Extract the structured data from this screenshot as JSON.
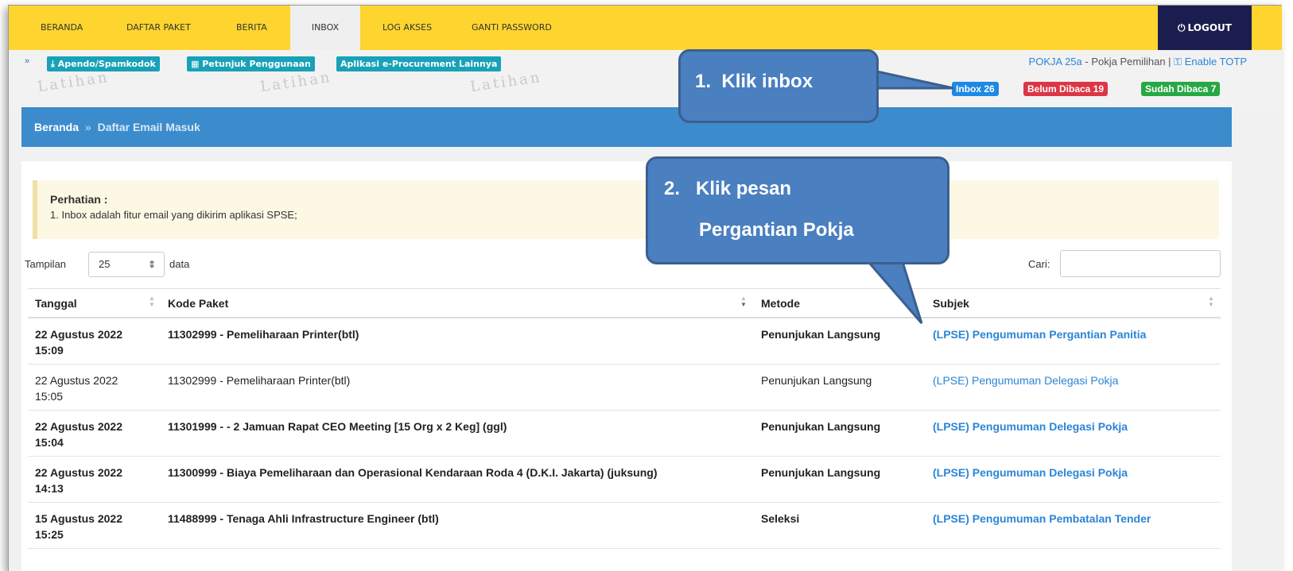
{
  "nav": {
    "items": [
      {
        "label": "BERANDA"
      },
      {
        "label": "DAFTAR PAKET"
      },
      {
        "label": "BERITA"
      },
      {
        "label": "INBOX"
      },
      {
        "label": "LOG AKSES"
      },
      {
        "label": "GANTI PASSWORD"
      }
    ],
    "active": "INBOX",
    "logout_label": "LOGOUT",
    "logout_icon": "power-icon"
  },
  "toolbar": {
    "collapse_icon": "double-chevron-up-icon",
    "buttons": [
      {
        "label": "Apendo/Spamkodok",
        "icon": "download-icon"
      },
      {
        "label": "Petunjuk Penggunaan",
        "icon": "book-icon"
      },
      {
        "label": "Aplikasi e-Procurement Lainnya",
        "icon": ""
      }
    ],
    "watermark": "Latihan"
  },
  "user": {
    "name": "POKJA 25a",
    "role": "- Pokja Pemilihan |",
    "totp_label": "Enable TOTP",
    "totp_icon": "key-icon"
  },
  "badges": {
    "inbox": "Inbox 26",
    "unread": "Belum Dibaca 19",
    "read": "Sudah Dibaca 7",
    "colors": {
      "inbox": "#1e88e5",
      "unread": "#dc3545",
      "read": "#28a745"
    }
  },
  "breadcrumb": {
    "home": "Beranda",
    "separator": "»",
    "current": "Daftar Email Masuk"
  },
  "alert": {
    "title": "Perhatian :",
    "text": "1. Inbox adalah fitur email yang dikirim aplikasi SPSE;"
  },
  "length_menu": {
    "prefix": "Tampilan",
    "value": "25",
    "suffix": "data"
  },
  "search": {
    "label": "Cari:",
    "value": ""
  },
  "table": {
    "headers": [
      "Tanggal",
      "Kode Paket",
      "Metode",
      "Subjek"
    ],
    "rows": [
      {
        "date": "22 Agustus 2022",
        "time": "15:09",
        "kode": "11302999",
        "nama": "- Pemeliharaan Printer(btl)",
        "metode": "Penunjukan Langsung",
        "subjek": "(LPSE) Pengumuman Pergantian Panitia",
        "unread": true
      },
      {
        "date": "22 Agustus 2022",
        "time": "15:05",
        "kode": "11302999",
        "nama": "- Pemeliharaan Printer(btl)",
        "metode": "Penunjukan Langsung",
        "subjek": "(LPSE) Pengumuman Delegasi Pokja",
        "unread": false
      },
      {
        "date": "22 Agustus 2022",
        "time": "15:04",
        "kode": "11301999",
        "nama": "- - 2 Jamuan Rapat CEO Meeting [15 Org x 2 Keg] (ggl)",
        "metode": "Penunjukan Langsung",
        "subjek": "(LPSE) Pengumuman Delegasi Pokja",
        "unread": true
      },
      {
        "date": "22 Agustus 2022",
        "time": "14:13",
        "kode": "11300999",
        "nama": "- Biaya Pemeliharaan dan Operasional Kendaraan Roda 4 (D.K.I. Jakarta) (juksung)",
        "metode": "Penunjukan Langsung",
        "subjek": "(LPSE) Pengumuman Delegasi Pokja",
        "unread": true
      },
      {
        "date": "15 Agustus 2022",
        "time": "15:25",
        "kode": "11488999",
        "nama": "- Tenaga Ahli Infrastructure Engineer (btl)",
        "metode": "Seleksi",
        "subjek": "(LPSE) Pengumuman Pembatalan Tender",
        "unread": true
      }
    ]
  },
  "callouts": {
    "one": {
      "num": "1.",
      "text": "Klik inbox"
    },
    "two": {
      "num": "2.",
      "line1": "Klik pesan",
      "line2": "Pergantian Pokja"
    }
  }
}
